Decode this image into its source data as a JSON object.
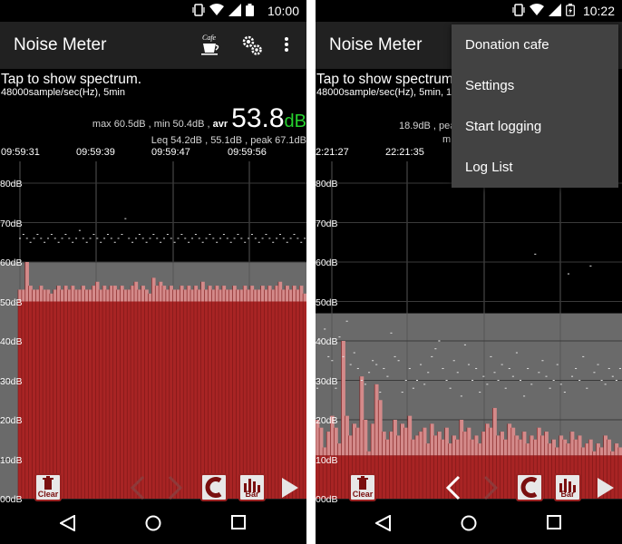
{
  "app_title": "Noise Meter",
  "left": {
    "status_time": "10:00",
    "tap_text": "Tap to show spectrum.",
    "rate_text": "48000sample/sec(Hz), 5min",
    "stats_max_min": "max 60.5dB , min 50.4dB ,",
    "stats_avr_label": "avr",
    "current_value": "53.8",
    "current_unit": "dB",
    "stats_leq": "Leq 54.2dB ,  55.1dB , peak 67.1dB",
    "time_labels": [
      "09:59:31",
      "09:59:39",
      "09:59:47",
      "09:59:56"
    ],
    "y_labels": [
      "80dB",
      "70dB",
      "60dB",
      "50dB",
      "40dB",
      "30dB",
      "20dB",
      "10dB",
      "00dB"
    ],
    "cafe_label": "Cafe",
    "clear_label": "Clear",
    "bar_label": "Bar",
    "avg_level_db": 60,
    "bars_db": [
      53,
      53,
      60,
      54,
      53,
      53,
      54,
      53,
      53,
      52,
      53,
      54,
      53,
      54,
      53,
      54,
      53,
      53,
      54,
      53,
      53,
      54,
      55,
      53,
      54,
      53,
      54,
      54,
      53,
      54,
      53,
      53,
      54,
      55,
      53,
      54,
      53,
      52,
      56,
      54,
      55,
      54,
      53,
      54,
      53,
      53,
      54,
      53,
      54,
      53,
      54,
      53,
      55,
      53,
      54,
      53,
      54,
      53,
      54,
      53,
      53,
      54,
      53,
      53,
      54,
      53,
      54,
      53,
      53,
      54,
      53,
      54,
      53,
      54,
      55,
      53,
      54,
      53,
      54,
      53,
      54,
      52
    ],
    "bars_floor_db": 50,
    "peaks_db": [
      66,
      67,
      66,
      65,
      66,
      67,
      66,
      65,
      66,
      67,
      66,
      65,
      66,
      67,
      66,
      65,
      66,
      68,
      66,
      65,
      66,
      67,
      66,
      65,
      66,
      67,
      66,
      65,
      66,
      67,
      71,
      66,
      65,
      66,
      67,
      66,
      65,
      66,
      67,
      66,
      65,
      66,
      67,
      66,
      65,
      66,
      67,
      66,
      65,
      66,
      67,
      66,
      65,
      66,
      67,
      66,
      65,
      66,
      67,
      66,
      65,
      66,
      67,
      66,
      65,
      66,
      67,
      66,
      65,
      66,
      67,
      66,
      65,
      66,
      67,
      66,
      65,
      66,
      67,
      66,
      65,
      66
    ]
  },
  "right": {
    "status_time": "10:22",
    "tap_text": "Tap to show spectrum.",
    "rate_text": "48000sample/sec(Hz), 5min, 1",
    "stats_fragment": "18.9dB , pea",
    "stats_fragment2": "m",
    "time_labels": [
      "2:21:27",
      "22:21:35"
    ],
    "y_labels": [
      "80dB",
      "70dB",
      "60dB",
      "50dB",
      "40dB",
      "30dB",
      "20dB",
      "10dB",
      "00dB"
    ],
    "clear_label": "Clear",
    "bar_label": "Bar",
    "menu": [
      "Donation cafe",
      "Settings",
      "Start logging",
      "Log List"
    ],
    "avg_level_db": 47,
    "bars_floor_db": 11,
    "bars_db": [
      20,
      18,
      13,
      17,
      21,
      18,
      14,
      40,
      21,
      16,
      19,
      18,
      31,
      20,
      12,
      19,
      29,
      25,
      17,
      15,
      17,
      20,
      16,
      19,
      18,
      21,
      15,
      16,
      17,
      18,
      14,
      19,
      16,
      17,
      15,
      18,
      14,
      16,
      15,
      20,
      17,
      18,
      15,
      16,
      14,
      17,
      19,
      18,
      23,
      16,
      17,
      15,
      19,
      18,
      16,
      15,
      17,
      14,
      16,
      15,
      18,
      16,
      17,
      14,
      15,
      13,
      16,
      15,
      14,
      17,
      15,
      16,
      13,
      14,
      15,
      12,
      14,
      13,
      16,
      15,
      12,
      14,
      13
    ],
    "peaks_db": [
      28,
      40,
      43,
      36,
      35,
      28,
      41,
      36,
      45,
      34,
      37,
      33,
      30,
      29,
      32,
      35,
      34,
      27,
      33,
      31,
      42,
      36,
      35,
      27,
      30,
      33,
      28,
      30,
      34,
      29,
      32,
      36,
      38,
      40,
      33,
      30,
      28,
      35,
      32,
      26,
      39,
      34,
      30,
      33,
      27,
      31,
      29,
      36,
      32,
      30,
      34,
      28,
      33,
      31,
      37,
      30,
      26,
      33,
      29,
      62,
      32,
      35,
      31,
      28,
      30,
      34,
      29,
      27,
      57,
      31,
      33,
      30,
      36,
      28,
      59,
      32,
      34,
      30,
      29,
      33,
      31,
      30,
      33
    ]
  }
}
